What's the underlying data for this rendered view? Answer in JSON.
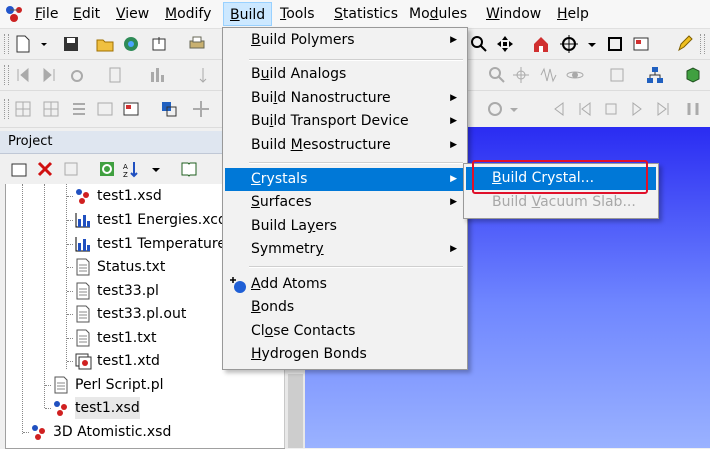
{
  "menubar": {
    "items": [
      {
        "pre": "",
        "key": "F",
        "post": "ile"
      },
      {
        "pre": "",
        "key": "E",
        "post": "dit"
      },
      {
        "pre": "",
        "key": "V",
        "post": "iew"
      },
      {
        "pre": "",
        "key": "M",
        "post": "odify"
      },
      {
        "pre": "",
        "key": "B",
        "post": "uild"
      },
      {
        "pre": "",
        "key": "T",
        "post": "ools"
      },
      {
        "pre": "",
        "key": "S",
        "post": "tatistics"
      },
      {
        "pre": "Mo",
        "key": "d",
        "post": "ules"
      },
      {
        "pre": "",
        "key": "W",
        "post": "indow"
      },
      {
        "pre": "",
        "key": "H",
        "post": "elp"
      }
    ]
  },
  "project": {
    "title": "Project",
    "tree": [
      {
        "label": "test1.xsd",
        "icon": "xsd-icon"
      },
      {
        "label": "test1 Energies.xcd",
        "icon": "chart-icon"
      },
      {
        "label": "test1 Temperature.xcd",
        "icon": "chart-icon"
      },
      {
        "label": "Status.txt",
        "icon": "text-file-icon"
      },
      {
        "label": "test33.pl",
        "icon": "text-file-icon"
      },
      {
        "label": "test33.pl.out",
        "icon": "text-file-icon"
      },
      {
        "label": "test1.txt",
        "icon": "text-file-icon"
      },
      {
        "label": "test1.xtd",
        "icon": "xtd-icon"
      },
      {
        "label": "Perl Script.pl",
        "icon": "text-file-icon"
      },
      {
        "label": "test1.xsd",
        "icon": "xsd-icon"
      },
      {
        "label": "3D Atomistic.xsd",
        "icon": "xsd-icon"
      }
    ]
  },
  "build_menu": {
    "items": [
      {
        "pre": "",
        "key": "B",
        "post": "uild Polymers",
        "submenu": true
      },
      {
        "pre": "B",
        "key": "u",
        "post": "ild Analogs",
        "submenu": false
      },
      {
        "pre": "Bui",
        "key": "l",
        "post": "d Nanostructure",
        "submenu": true
      },
      {
        "pre": "Bu",
        "key": "i",
        "post": "ld Transport Device",
        "submenu": true
      },
      {
        "pre": "Build ",
        "key": "M",
        "post": "esostructure",
        "submenu": true
      },
      {
        "pre": "",
        "key": "C",
        "post": "rystals",
        "submenu": true
      },
      {
        "pre": "",
        "key": "S",
        "post": "urfaces",
        "submenu": true
      },
      {
        "pre": "Build La",
        "key": "y",
        "post": "ers",
        "submenu": false
      },
      {
        "pre": "Symmetr",
        "key": "y",
        "post": "",
        "submenu": true
      },
      {
        "pre": "",
        "key": "A",
        "post": "dd Atoms",
        "submenu": false
      },
      {
        "pre": "",
        "key": "B",
        "post": "onds",
        "submenu": false
      },
      {
        "pre": "Cl",
        "key": "o",
        "post": "se Contacts",
        "submenu": false
      },
      {
        "pre": "",
        "key": "H",
        "post": "ydrogen Bonds",
        "submenu": false
      }
    ]
  },
  "crystals_submenu": {
    "items": [
      {
        "pre": "",
        "key": "B",
        "post": "uild Crystal...",
        "enabled": true
      },
      {
        "pre": "Build ",
        "key": "V",
        "post": "acuum Slab...",
        "enabled": false
      }
    ]
  },
  "colors": {
    "highlight": "#0078d7",
    "annotation": "#e0102a",
    "doc_top": "#2a2cf2"
  }
}
